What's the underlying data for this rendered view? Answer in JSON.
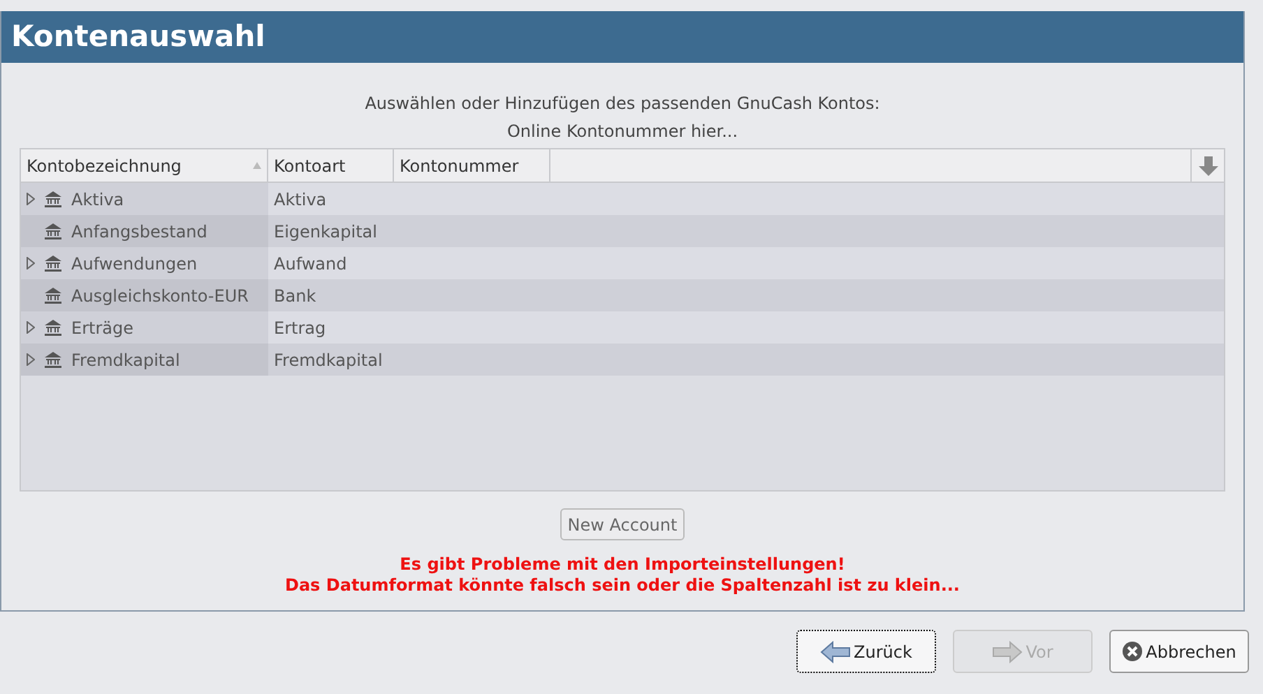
{
  "window": {
    "title": "Kontenauswahl"
  },
  "instructions": [
    "Auswählen oder Hinzufügen des passenden GnuCash Kontos:",
    "Online Kontonummer hier..."
  ],
  "table": {
    "columns": [
      {
        "label": "Kontobezeichnung",
        "sorted": true
      },
      {
        "label": "Kontoart",
        "sorted": false
      },
      {
        "label": "Kontonummer",
        "sorted": false
      }
    ],
    "rows": [
      {
        "name": "Aktiva",
        "type": "Aktiva",
        "expandable": true
      },
      {
        "name": "Anfangsbestand",
        "type": "Eigenkapital",
        "expandable": false
      },
      {
        "name": "Aufwendungen",
        "type": "Aufwand",
        "expandable": true
      },
      {
        "name": "Ausgleichskonto-EUR",
        "type": "Bank",
        "expandable": false
      },
      {
        "name": "Erträge",
        "type": "Ertrag",
        "expandable": true
      },
      {
        "name": "Fremdkapital",
        "type": "Fremdkapital",
        "expandable": true
      }
    ]
  },
  "new_account_button": "New Account",
  "error_lines": [
    "Es gibt Probleme mit den Importeinstellungen!",
    "Das Datumformat könnte falsch sein oder die Spaltenzahl ist zu klein..."
  ],
  "buttons": [
    {
      "label": "Zurück",
      "kind": "back",
      "disabled": false
    },
    {
      "label": "Vor",
      "kind": "forward",
      "disabled": true
    },
    {
      "label": "Abbrechen",
      "kind": "cancel",
      "disabled": false
    }
  ]
}
